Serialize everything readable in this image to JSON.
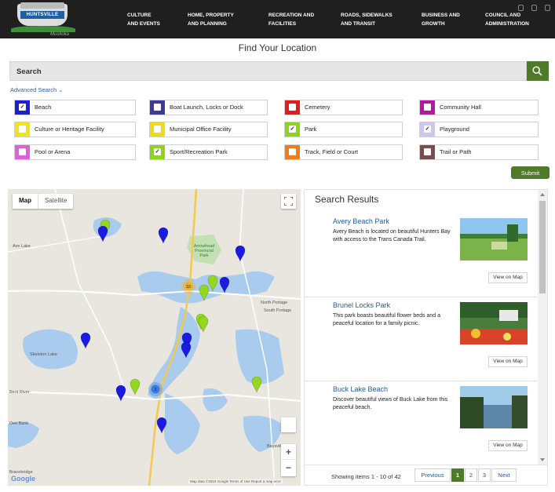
{
  "logo": {
    "name": "HUNTSVILLE",
    "subtitle": "Muskoka"
  },
  "nav": [
    {
      "label": "CULTURE\nAND EVENTS"
    },
    {
      "label": "HOME, PROPERTY\nAND PLANNING"
    },
    {
      "label": "RECREATION AND\nFACILITIES"
    },
    {
      "label": "ROADS, SIDEWALKS\nAND TRANSIT"
    },
    {
      "label": "BUSINESS AND\nGROWTH"
    },
    {
      "label": "COUNCIL AND\nADMINISTRATION"
    }
  ],
  "page_title": "Find Your Location",
  "search": {
    "label": "Search"
  },
  "advanced_search": "Advanced Search",
  "categories": [
    {
      "label": "Beach",
      "color": "#1e1ed2",
      "checked": true
    },
    {
      "label": "Boat Launch, Locks or Dock",
      "color": "#3e3a9a",
      "checked": false
    },
    {
      "label": "Cemetery",
      "color": "#e51c1c",
      "checked": false
    },
    {
      "label": "Community Hall",
      "color": "#b5179e",
      "checked": false
    },
    {
      "label": "Culture or Heritage Facility",
      "color": "#f5e31a",
      "checked": false
    },
    {
      "label": "Municipal Office Facility",
      "color": "#f0dc14",
      "checked": false
    },
    {
      "label": "Park",
      "color": "#8ad41a",
      "checked": true
    },
    {
      "label": "Playground",
      "color": "#cfc6ef",
      "checked": true
    },
    {
      "label": "Pool or Arena",
      "color": "#e35de0",
      "checked": false
    },
    {
      "label": "Sport/Recreation Park",
      "color": "#8fd41c",
      "checked": true
    },
    {
      "label": "Track, Field or Court",
      "color": "#ef7d1a",
      "checked": false
    },
    {
      "label": "Trail or Path",
      "color": "#7a4b4b",
      "checked": false
    }
  ],
  "submit_label": "Submit",
  "map": {
    "tab_map": "Map",
    "tab_satellite": "Satellite",
    "zoom_in": "+",
    "zoom_out": "−",
    "google": "Google",
    "attribution": "Map data ©2019 Google    Terms of Use    Report a map error",
    "cluster_count": "10",
    "cluster_small": "3",
    "labels": [
      {
        "text": "Ave Lake"
      },
      {
        "text": "Arrowhead Provincial Park"
      },
      {
        "text": "North Portage"
      },
      {
        "text": "South Portage"
      },
      {
        "text": "Skeleton Lake"
      },
      {
        "text": "Bent River"
      },
      {
        "text": "Dee Bank"
      },
      {
        "text": "Baysville"
      },
      {
        "text": "Bracebridge"
      }
    ]
  },
  "results": {
    "heading": "Search Results",
    "items": [
      {
        "title": "Avery Beach Park",
        "desc": "Avery Beach is located on beautiful Hunters Bay with access to the Trans Canada Trail.",
        "view": "View on Map"
      },
      {
        "title": "Brunel Locks Park",
        "desc": "This park boasts beautiful flower beds and a peaceful location for a family picnic.",
        "view": "View on Map"
      },
      {
        "title": "Buck Lake Beach",
        "desc": "Discover beautiful views of Buck Lake from this peaceful beach.",
        "view": "View on Map"
      }
    ],
    "showing": "Showing items 1 - 10 of 42",
    "pager": {
      "previous": "Previous",
      "p1": "1",
      "p2": "2",
      "p3": "3",
      "next": "Next"
    }
  }
}
